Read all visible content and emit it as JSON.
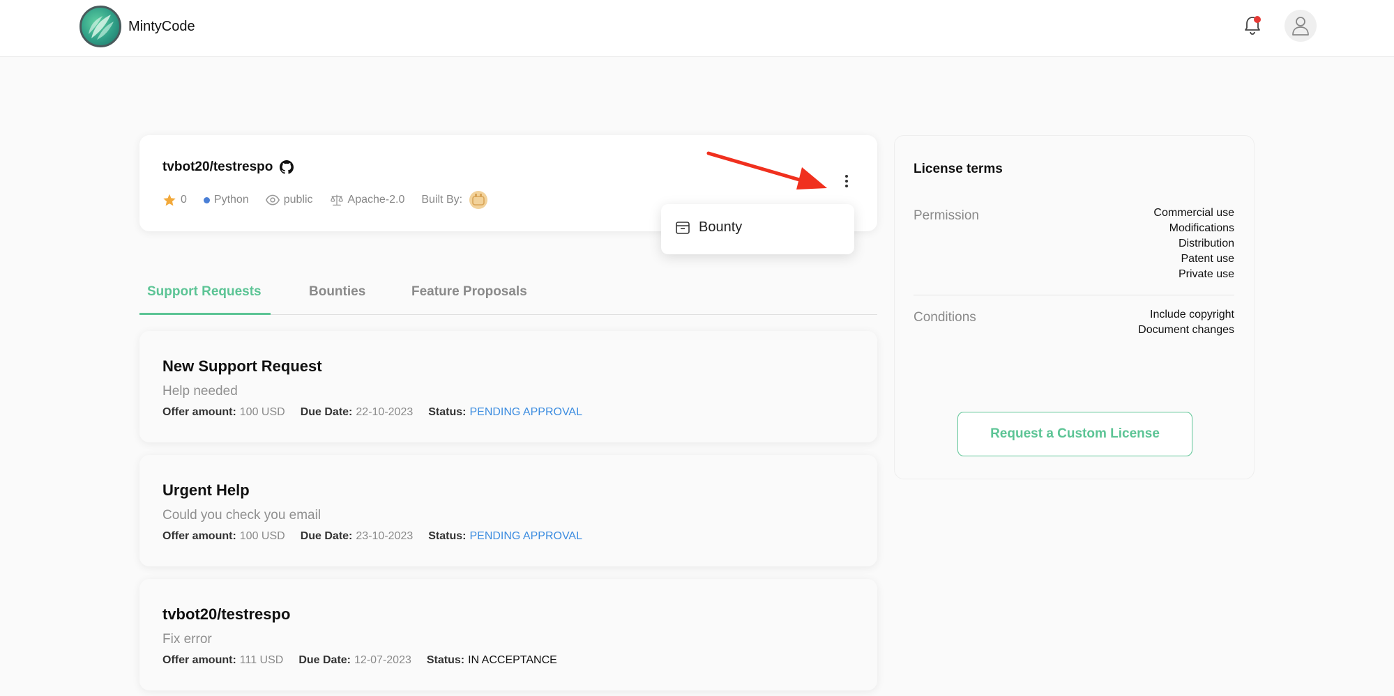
{
  "header": {
    "brand": "MintyCode"
  },
  "repo": {
    "name": "tvbot20/testrespo",
    "stars": "0",
    "language": "Python",
    "visibility": "public",
    "license": "Apache-2.0",
    "built_by_label": "Built By:"
  },
  "dropdown": {
    "items": [
      {
        "label": "Bounty"
      }
    ]
  },
  "tabs": [
    {
      "label": "Support Requests"
    },
    {
      "label": "Bounties"
    },
    {
      "label": "Feature Proposals"
    }
  ],
  "labels": {
    "offer": "Offer amount:",
    "due": "Due Date:",
    "status": "Status:"
  },
  "requests": [
    {
      "title": "New Support Request",
      "desc": "Help needed",
      "offer": "100 USD",
      "due": "22-10-2023",
      "status": "PENDING APPROVAL"
    },
    {
      "title": "Urgent Help",
      "desc": "Could you check you email",
      "offer": "100 USD",
      "due": "23-10-2023",
      "status": "PENDING APPROVAL"
    },
    {
      "title": "tvbot20/testrespo",
      "desc": "Fix error",
      "offer": "111 USD",
      "due": "12-07-2023",
      "status": "IN ACCEPTANCE"
    }
  ],
  "license": {
    "title": "License terms",
    "permission_label": "Permission",
    "permissions": [
      "Commercial use",
      "Modifications",
      "Distribution",
      "Patent use",
      "Private use"
    ],
    "conditions_label": "Conditions",
    "conditions": [
      "Include copyright",
      "Document changes"
    ],
    "button": "Request a Custom License"
  },
  "colors": {
    "accent": "#5cc495",
    "pending": "#3d8de0",
    "arrow": "#f0301e"
  }
}
